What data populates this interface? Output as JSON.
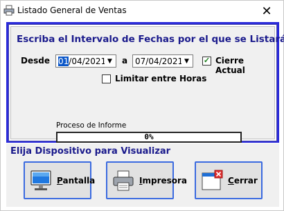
{
  "window": {
    "title": "Listado General de Ventas",
    "close_glyph": "✕"
  },
  "form": {
    "heading": "Escriba el Intervalo de Fechas por el que se Listará:",
    "desde_label": "Desde",
    "a_label": "a",
    "from_date_selected": "01",
    "from_date_rest": "/04/2021",
    "to_date": "07/04/2021",
    "cierre_actual_label": "Cierre Actual",
    "cierre_actual_checked": true,
    "limitar_horas_label": "Limitar entre Horas",
    "limitar_horas_checked": false
  },
  "progress": {
    "label": "Proceso de Informe",
    "value_text": "0%",
    "value": 0
  },
  "devices": {
    "label": "Elija Dispositivo para Visualizar",
    "buttons": [
      {
        "mnemonic": "P",
        "rest": "antalla",
        "icon": "monitor-icon"
      },
      {
        "mnemonic": "I",
        "rest": "mpresora",
        "icon": "printer-icon"
      },
      {
        "mnemonic": "C",
        "rest": "errar",
        "icon": "close-window-icon"
      }
    ]
  },
  "colors": {
    "frame_blue": "#2929d9",
    "heading_navy": "#1a1a8c",
    "button_border": "#3a6ae0",
    "selection": "#0a56c8"
  }
}
